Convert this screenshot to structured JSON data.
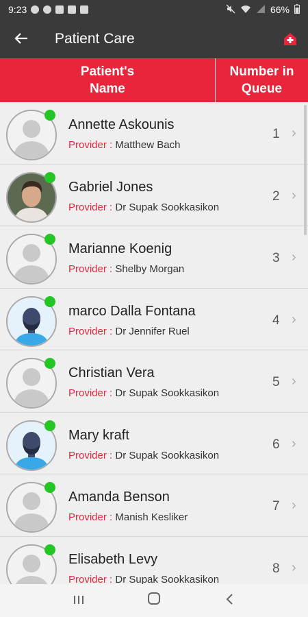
{
  "status_bar": {
    "time": "9:23",
    "battery": "66%"
  },
  "app_bar": {
    "title": "Patient Care",
    "back_icon": "arrow-left-icon",
    "home_icon": "medical-home-icon"
  },
  "table_header": {
    "name_col": "Patient's\nName",
    "queue_col": "Number in\nQueue"
  },
  "colors": {
    "accent": "#e8253a",
    "online": "#25c525",
    "app_bar": "#3a3a3a"
  },
  "patients": [
    {
      "name": "Annette Askounis",
      "provider_label": "Provider :",
      "provider": "Matthew Bach",
      "queue": "1",
      "avatar": "placeholder"
    },
    {
      "name": "Gabriel  Jones",
      "provider_label": "Provider :",
      "provider": "Dr Supak Sookkasikon",
      "queue": "2",
      "avatar": "photo"
    },
    {
      "name": "Marianne Koenig",
      "provider_label": "Provider :",
      "provider": "Shelby Morgan",
      "queue": "3",
      "avatar": "placeholder"
    },
    {
      "name": "marco Dalla Fontana",
      "provider_label": "Provider :",
      "provider": "Dr Jennifer Ruel",
      "queue": "4",
      "avatar": "illustration"
    },
    {
      "name": "Christian Vera",
      "provider_label": "Provider :",
      "provider": "Dr Supak Sookkasikon",
      "queue": "5",
      "avatar": "placeholder"
    },
    {
      "name": "Mary kraft",
      "provider_label": "Provider :",
      "provider": "Dr Supak Sookkasikon",
      "queue": "6",
      "avatar": "illustration"
    },
    {
      "name": "Amanda Benson",
      "provider_label": "Provider :",
      "provider": "Manish Kesliker",
      "queue": "7",
      "avatar": "placeholder"
    },
    {
      "name": "Elisabeth Levy",
      "provider_label": "Provider :",
      "provider": "Dr Supak Sookkasikon",
      "queue": "8",
      "avatar": "placeholder"
    }
  ]
}
